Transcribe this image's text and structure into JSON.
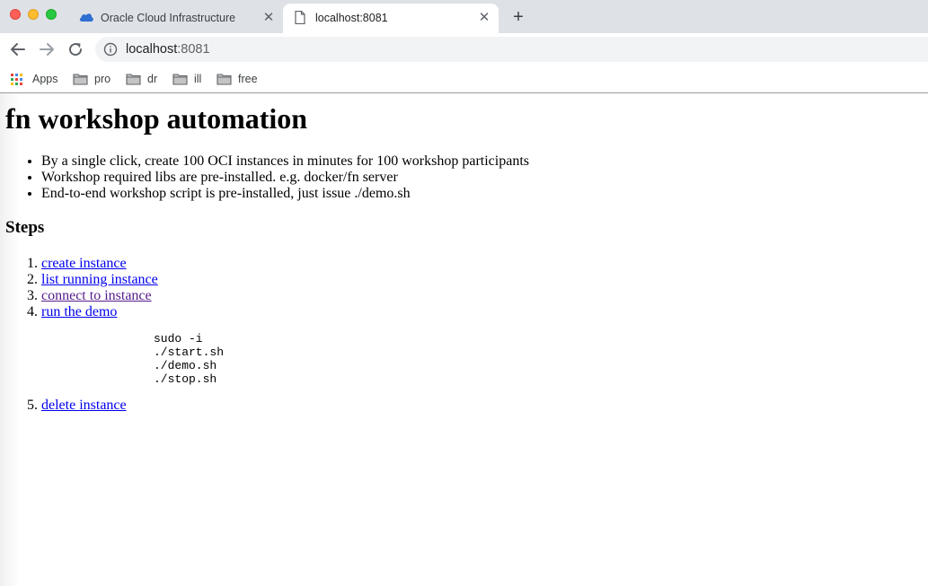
{
  "browser": {
    "tabs": [
      {
        "title": "Oracle Cloud Infrastructure",
        "icon": "cloud-icon",
        "active": false
      },
      {
        "title": "localhost:8081",
        "icon": "page-icon",
        "active": true
      }
    ],
    "close_glyph": "✕",
    "new_tab_glyph": "+",
    "url_host": "localhost",
    "url_port": ":8081",
    "bookmarks": [
      {
        "label": "Apps",
        "icon": "apps-grid-icon"
      },
      {
        "label": "pro",
        "icon": "folder-icon"
      },
      {
        "label": "dr",
        "icon": "folder-icon"
      },
      {
        "label": "ill",
        "icon": "folder-icon"
      },
      {
        "label": "free",
        "icon": "folder-icon"
      }
    ]
  },
  "page": {
    "title": "fn workshop automation",
    "features": [
      "By a single click, create 100 OCI instances in minutes for 100 workshop participants",
      "Workshop required libs are pre-installed. e.g. docker/fn server",
      "End-to-end workshop script is pre-installed, just issue ./demo.sh"
    ],
    "steps_heading": "Steps",
    "steps": [
      {
        "label": "create instance"
      },
      {
        "label": "list running instance"
      },
      {
        "label": "connect to instance"
      },
      {
        "label": "run the demo"
      }
    ],
    "demo_commands": "sudo -i\n./start.sh\n./demo.sh\n./stop.sh",
    "final_step": {
      "label": "delete instance"
    }
  },
  "colors": {
    "link": "#0000ee",
    "visited_link": "#551a8b",
    "tabstrip": "#dee1e6"
  }
}
